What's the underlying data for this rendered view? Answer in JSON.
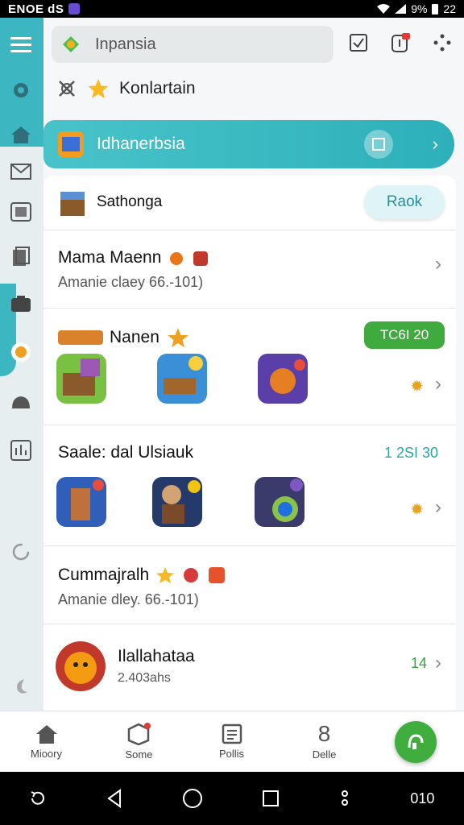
{
  "status_bar": {
    "left_text": "ENOE dS",
    "right_text": "9%",
    "time": "22"
  },
  "header": {
    "search_text": "Inpansia"
  },
  "favorites": {
    "label": "Konlartain"
  },
  "banner": {
    "label": "Idhanerbsia"
  },
  "sections": {
    "read_card": {
      "title": "Sathonga",
      "button": "Raok"
    },
    "row1": {
      "title": "Mama  Maenn",
      "subtitle": "Amanie claey  66.-101)"
    },
    "games1": {
      "title": "Nanen",
      "badge": "TC6I 20"
    },
    "games2": {
      "title": "Saale: dal Ulsiauk",
      "count": "1 2SI 30"
    },
    "row2": {
      "title": "Cummajralh",
      "subtitle": "Amanie dley. 66.-101)"
    },
    "row3": {
      "title": "Ilallahataa",
      "subtitle": "2.403ahs",
      "count": "14"
    }
  },
  "bottom_nav": {
    "items": [
      {
        "label": "Mioory",
        "icon": "home-icon"
      },
      {
        "label": "Some",
        "icon": "box-icon"
      },
      {
        "label": "Pollis",
        "icon": "document-icon"
      },
      {
        "label": "Delle",
        "icon": "person-icon",
        "glyph": "8"
      }
    ]
  },
  "system_nav": {
    "right_text": "010"
  },
  "colors": {
    "accent": "#3cb7c2",
    "green": "#3fae3f"
  }
}
